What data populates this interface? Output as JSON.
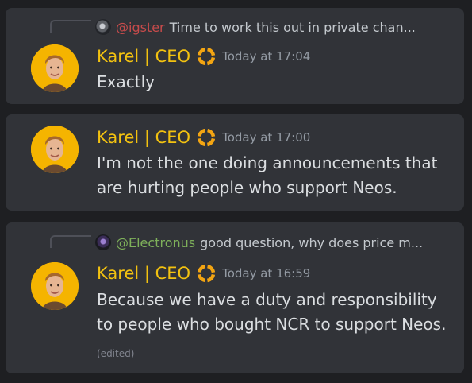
{
  "messages": [
    {
      "reply": {
        "username": "@igster",
        "text": "Time to work this out in private chan..."
      },
      "author": "Karel | CEO",
      "timestamp": "Today at 17:04",
      "lines": [
        "Exactly"
      ]
    },
    {
      "author": "Karel | CEO",
      "timestamp": "Today at 17:00",
      "lines": [
        "I'm not the one doing announcements that",
        "are hurting people who support Neos."
      ]
    },
    {
      "reply": {
        "username": "@Electronus",
        "text": "good question, why does price m..."
      },
      "author": "Karel | CEO",
      "timestamp": "Today at 16:59",
      "lines": [
        "Because we have a duty and responsibility",
        "to people who bought NCR to support Neos."
      ],
      "edited": "(edited)"
    }
  ],
  "icons": {
    "reply_spine": "reply-spine-icon",
    "avatar": "karel-avatar",
    "role": "role-badge-icon"
  },
  "colors": {
    "background": "#1e1f22",
    "card": "#313338",
    "author_name": "#f3c210",
    "timestamp": "#949ba4",
    "message_text": "#dbdee1",
    "igster_name": "#c64b4b",
    "electronus_name": "#7eb05a",
    "avatar_bg": "#f5b400"
  }
}
